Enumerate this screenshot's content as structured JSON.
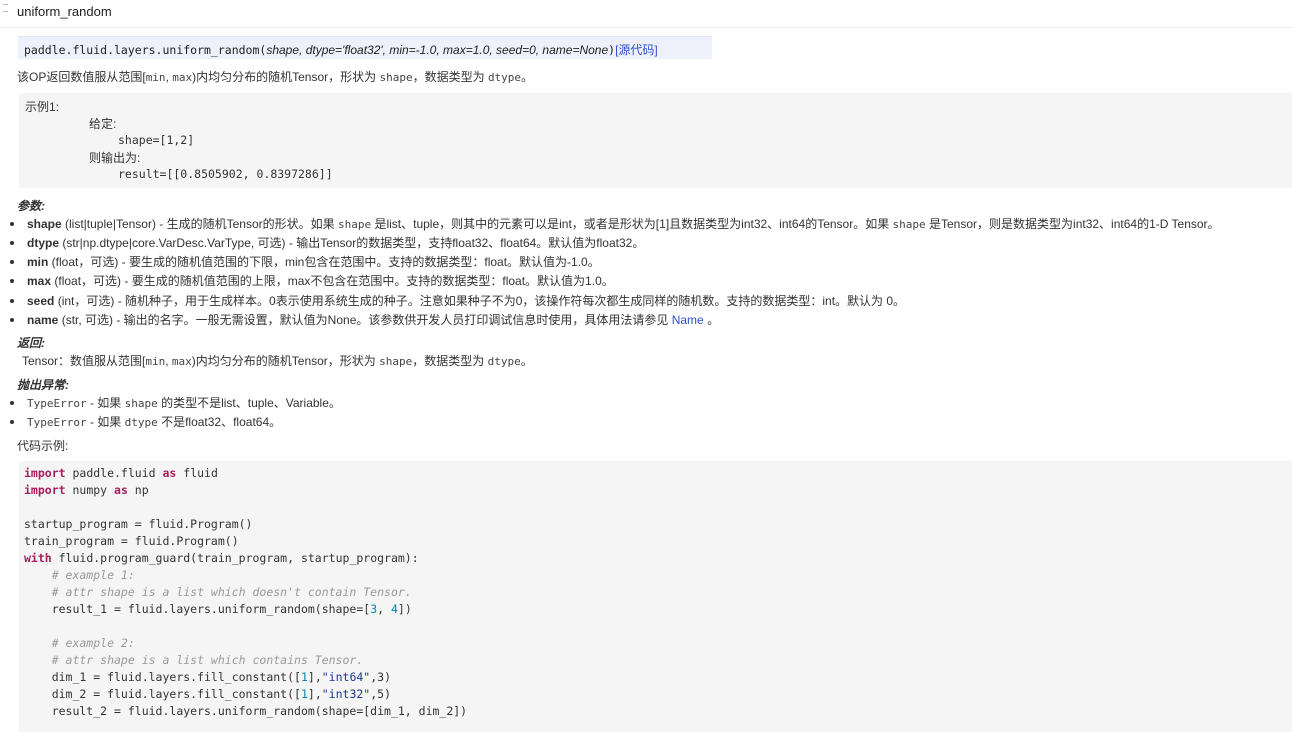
{
  "title": "uniform_random",
  "signature": {
    "prefix": "paddle.fluid.layers.uniform_random(",
    "args": "shape, dtype='float32', min=-1.0, max=1.0, seed=0, name=None",
    "suffix": ")",
    "source_link": "[源代码]"
  },
  "description": {
    "part1": "该OP返回数值服从范围[",
    "min": "min",
    "sep": ", ",
    "max": "max",
    "part2": ")内均匀分布的随机Tensor，形状为 ",
    "shape": "shape",
    "part3": "，数据类型为 ",
    "dtype": "dtype",
    "part4": "。"
  },
  "example": {
    "line1": "示例1:",
    "line2": "给定:",
    "line3": "shape=[1,2]",
    "line4": "则输出为:",
    "line5": "result=[[0.8505902, 0.8397286]]"
  },
  "params_heading": "参数:",
  "params": [
    {
      "name": "shape",
      "p1": " (list|tuple|Tensor) - 生成的随机Tensor的形状。如果 ",
      "c1": "shape",
      "p2": " 是list、tuple，则其中的元素可以是int，或者是形状为[1]且数据类型为int32、int64的Tensor。如果 ",
      "c2": "shape",
      "p3": " 是Tensor，则是数据类型为int32、int64的1-D Tensor。"
    },
    {
      "name": "dtype",
      "p1": " (str|np.dtype|core.VarDesc.VarType, 可选) - 输出Tensor的数据类型，支持float32、float64。默认值为float32。"
    },
    {
      "name": "min",
      "p1": " (float，可选) - 要生成的随机值范围的下限，min包含在范围中。支持的数据类型：float。默认值为-1.0。"
    },
    {
      "name": "max",
      "p1": " (float，可选) - 要生成的随机值范围的上限，max不包含在范围中。支持的数据类型：float。默认值为1.0。"
    },
    {
      "name": "seed",
      "p1": " (int，可选) - 随机种子，用于生成样本。0表示使用系统生成的种子。注意如果种子不为0，该操作符每次都生成同样的随机数。支持的数据类型：int。默认为 0。"
    },
    {
      "name": "name",
      "p1": " (str, 可选) - 输出的名字。一般无需设置，默认值为None。该参数供开发人员打印调试信息时使用，具体用法请参见 ",
      "link": "Name",
      "p2": " 。"
    }
  ],
  "returns_heading": "返回:",
  "returns": {
    "part1": "Tensor：数值服从范围[",
    "min": "min",
    "sep": ", ",
    "max": "max",
    "part2": ")内均匀分布的随机Tensor，形状为 ",
    "shape": "shape",
    "part3": "，数据类型为 ",
    "dtype": "dtype",
    "part4": "。"
  },
  "raises_heading": "抛出异常:",
  "raises": [
    {
      "error": "TypeError",
      "p1": " - 如果 ",
      "c1": "shape",
      "p2": " 的类型不是list、tuple、Variable。"
    },
    {
      "error": "TypeError",
      "p1": " - 如果 ",
      "c1": "dtype",
      "p2": " 不是float32、float64。"
    }
  ],
  "code_heading": "代码示例:",
  "code": {
    "l1_kw": "import",
    "l1_a": " paddle.fluid ",
    "l1_kw2": "as",
    "l1_b": " fluid",
    "l2_kw": "import",
    "l2_a": " numpy ",
    "l2_kw2": "as",
    "l2_b": " np",
    "l4": "startup_program = fluid.Program()",
    "l5": "train_program = fluid.Program()",
    "l6_kw": "with",
    "l6_a": " fluid.program_guard(train_program, startup_program):",
    "l7": "    # example 1:",
    "l8": "    # attr shape is a list which doesn't contain Tensor.",
    "l9_a": "    result_1 = fluid.layers.uniform_random(shape=[",
    "l9_n1": "3",
    "l9_b": ", ",
    "l9_n2": "4",
    "l9_c": "])",
    "l11": "    # example 2:",
    "l12": "    # attr shape is a list which contains Tensor.",
    "l13_a": "    dim_1 = fluid.layers.fill_constant([",
    "l13_n": "1",
    "l13_b": "],",
    "l13_s": "\"int64\"",
    "l13_c": ",3)",
    "l14_a": "    dim_2 = fluid.layers.fill_constant([",
    "l14_n": "1",
    "l14_b": "],",
    "l14_s": "\"int32\"",
    "l14_c": ",5)",
    "l15": "    result_2 = fluid.layers.uniform_random(shape=[dim_1, dim_2])"
  },
  "colors": {
    "keyword": "#a71d5d",
    "comment": "#999999",
    "number": "#0086b3",
    "string": "#183691",
    "link": "#2f4fd2",
    "signature_bg": "#eef0fb",
    "code_bg": "#f5f5f5"
  }
}
